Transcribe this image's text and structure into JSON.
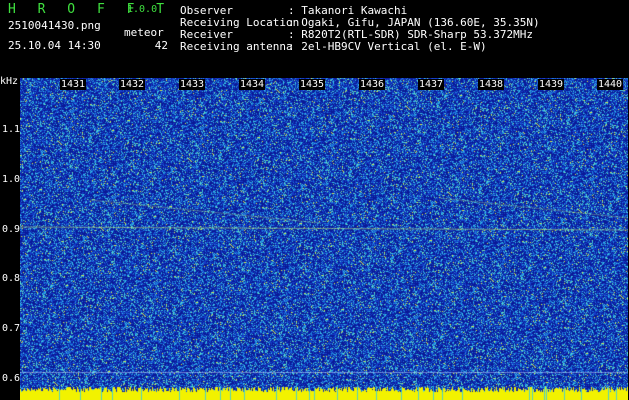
{
  "header": {
    "app_title": "H R O F F T",
    "version": "1.0.0",
    "filename": "2510041430.png",
    "datetime": "25.10.04 14:30",
    "meteor_label": "meteor",
    "meteor_count": "42"
  },
  "info": [
    {
      "label": "Observer",
      "value": ": Takanori Kawachi"
    },
    {
      "label": "Receiving Location",
      "value": ": Ogaki, Gifu, JAPAN (136.60E, 35.35N)"
    },
    {
      "label": "Receiver",
      "value": ": R820T2(RTL-SDR) SDR-Sharp 53.372MHz"
    },
    {
      "label": "Receiving antenna",
      "value": ": 2el-HB9CV Vertical (el. E-W)"
    }
  ],
  "axis": {
    "y_unit": "kHz",
    "y_ticks": [
      "1.1",
      "1.0",
      "0.9",
      "0.8",
      "0.7",
      "0.6"
    ],
    "x_ticks": [
      "1431",
      "1432",
      "1433",
      "1434",
      "1435",
      "1436",
      "1437",
      "1438",
      "1439",
      "1440"
    ]
  },
  "colors": {
    "background": "#000000",
    "waterfall_base": "#1a2fb0",
    "signal": "#3fd0ff",
    "strong": "#ffff00",
    "title": "#3fe03f"
  }
}
